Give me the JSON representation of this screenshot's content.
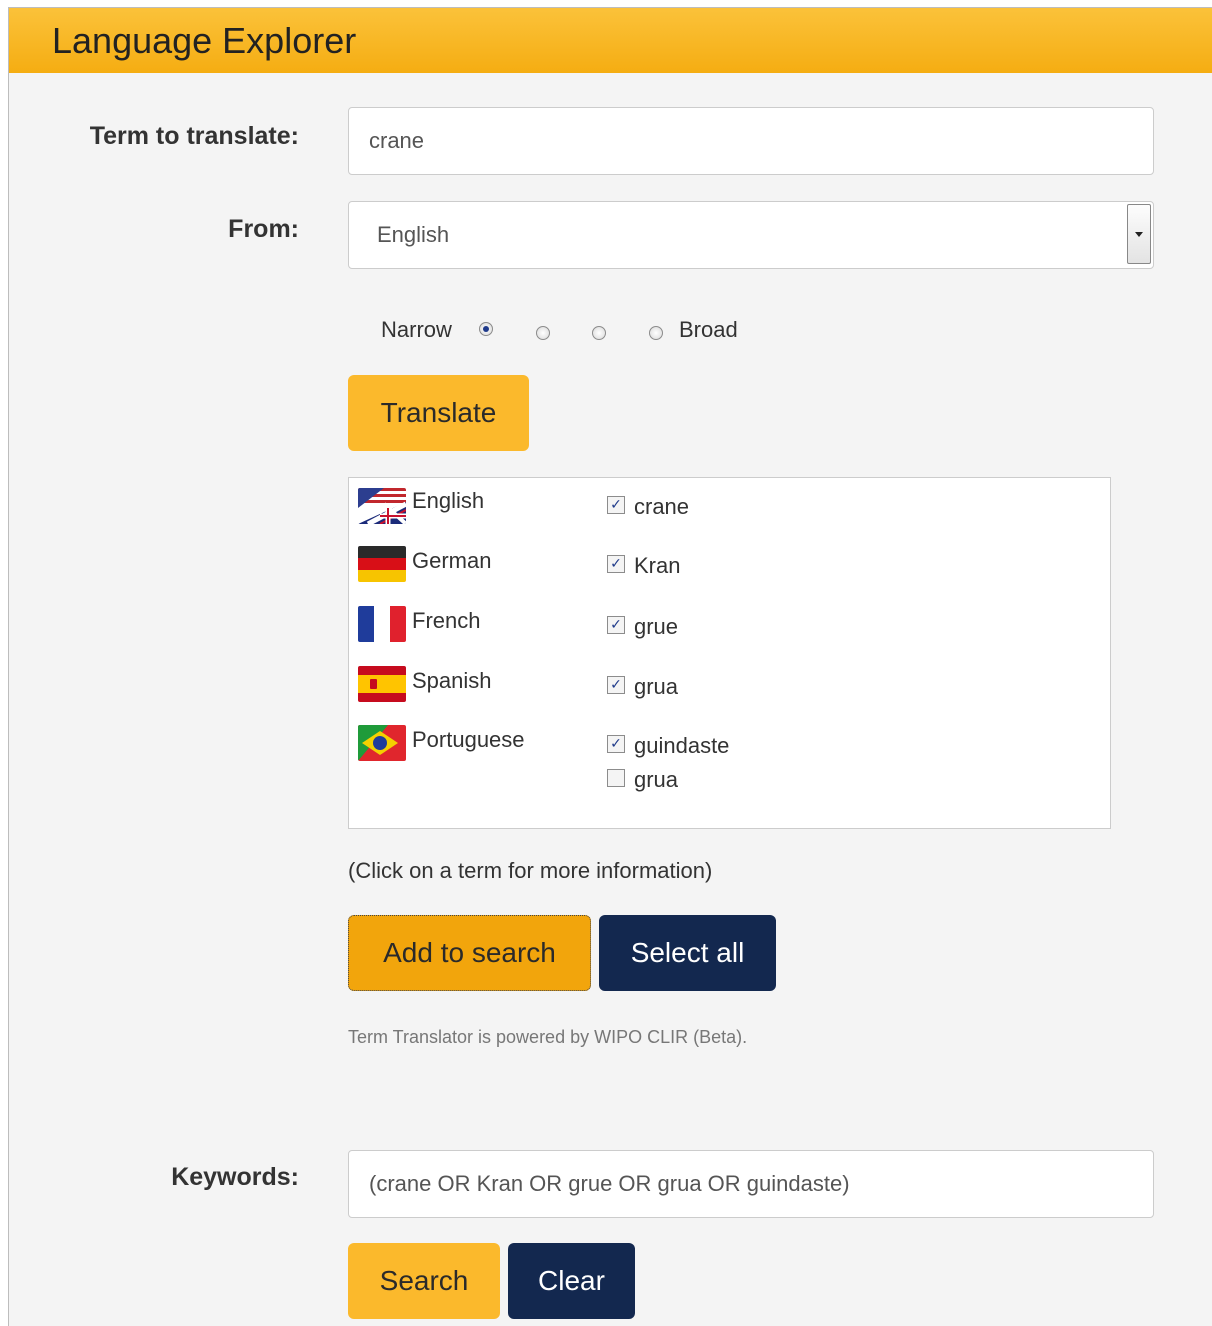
{
  "header": {
    "title": "Language Explorer"
  },
  "form": {
    "term_label": "Term to translate:",
    "term_value": "crane",
    "from_label": "From:",
    "from_value": "English",
    "scope": {
      "narrow": "Narrow",
      "broad": "Broad",
      "selected": "Narrow"
    },
    "translate_label": "Translate"
  },
  "results": [
    {
      "language": "English",
      "flag": "uk-usa-flag-icon",
      "terms": [
        {
          "text": "crane",
          "checked": true
        }
      ]
    },
    {
      "language": "German",
      "flag": "germany-flag-icon",
      "terms": [
        {
          "text": "Kran",
          "checked": true
        }
      ]
    },
    {
      "language": "French",
      "flag": "france-flag-icon",
      "terms": [
        {
          "text": "grue",
          "checked": true
        }
      ]
    },
    {
      "language": "Spanish",
      "flag": "spain-flag-icon",
      "terms": [
        {
          "text": "grua",
          "checked": true
        }
      ]
    },
    {
      "language": "Portuguese",
      "flag": "brazil-portugal-flag-icon",
      "terms": [
        {
          "text": "guindaste",
          "checked": true
        },
        {
          "text": "grua",
          "checked": false
        }
      ]
    }
  ],
  "note": "(Click on a term for more information)",
  "buttons": {
    "add_to_search": "Add to search",
    "select_all": "Select all",
    "search": "Search",
    "clear": "Clear"
  },
  "powered_by": "Term Translator is powered by WIPO CLIR (Beta).",
  "keywords": {
    "label": "Keywords:",
    "value": "(crane OR Kran OR grue OR grua OR guindaste)"
  },
  "colors": {
    "header": "#fbb92c",
    "accent_yellow": "#fbb92c",
    "navy": "#13284f"
  }
}
